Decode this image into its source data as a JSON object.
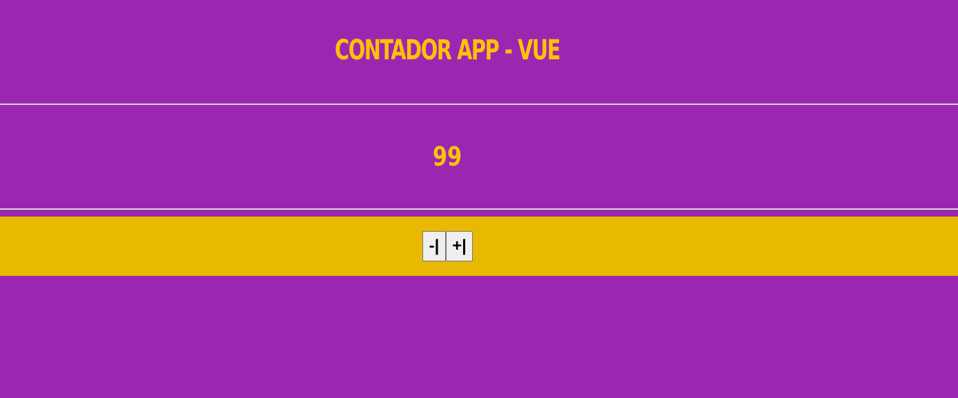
{
  "header": {
    "title": "CONTADOR APP - VUE"
  },
  "counter": {
    "value": "99"
  },
  "controls": {
    "decrement_label": "-|",
    "increment_label": "+|"
  },
  "colors": {
    "background": "#9b27b0",
    "accent": "#ffc107",
    "controls_bar": "#e8b900"
  }
}
